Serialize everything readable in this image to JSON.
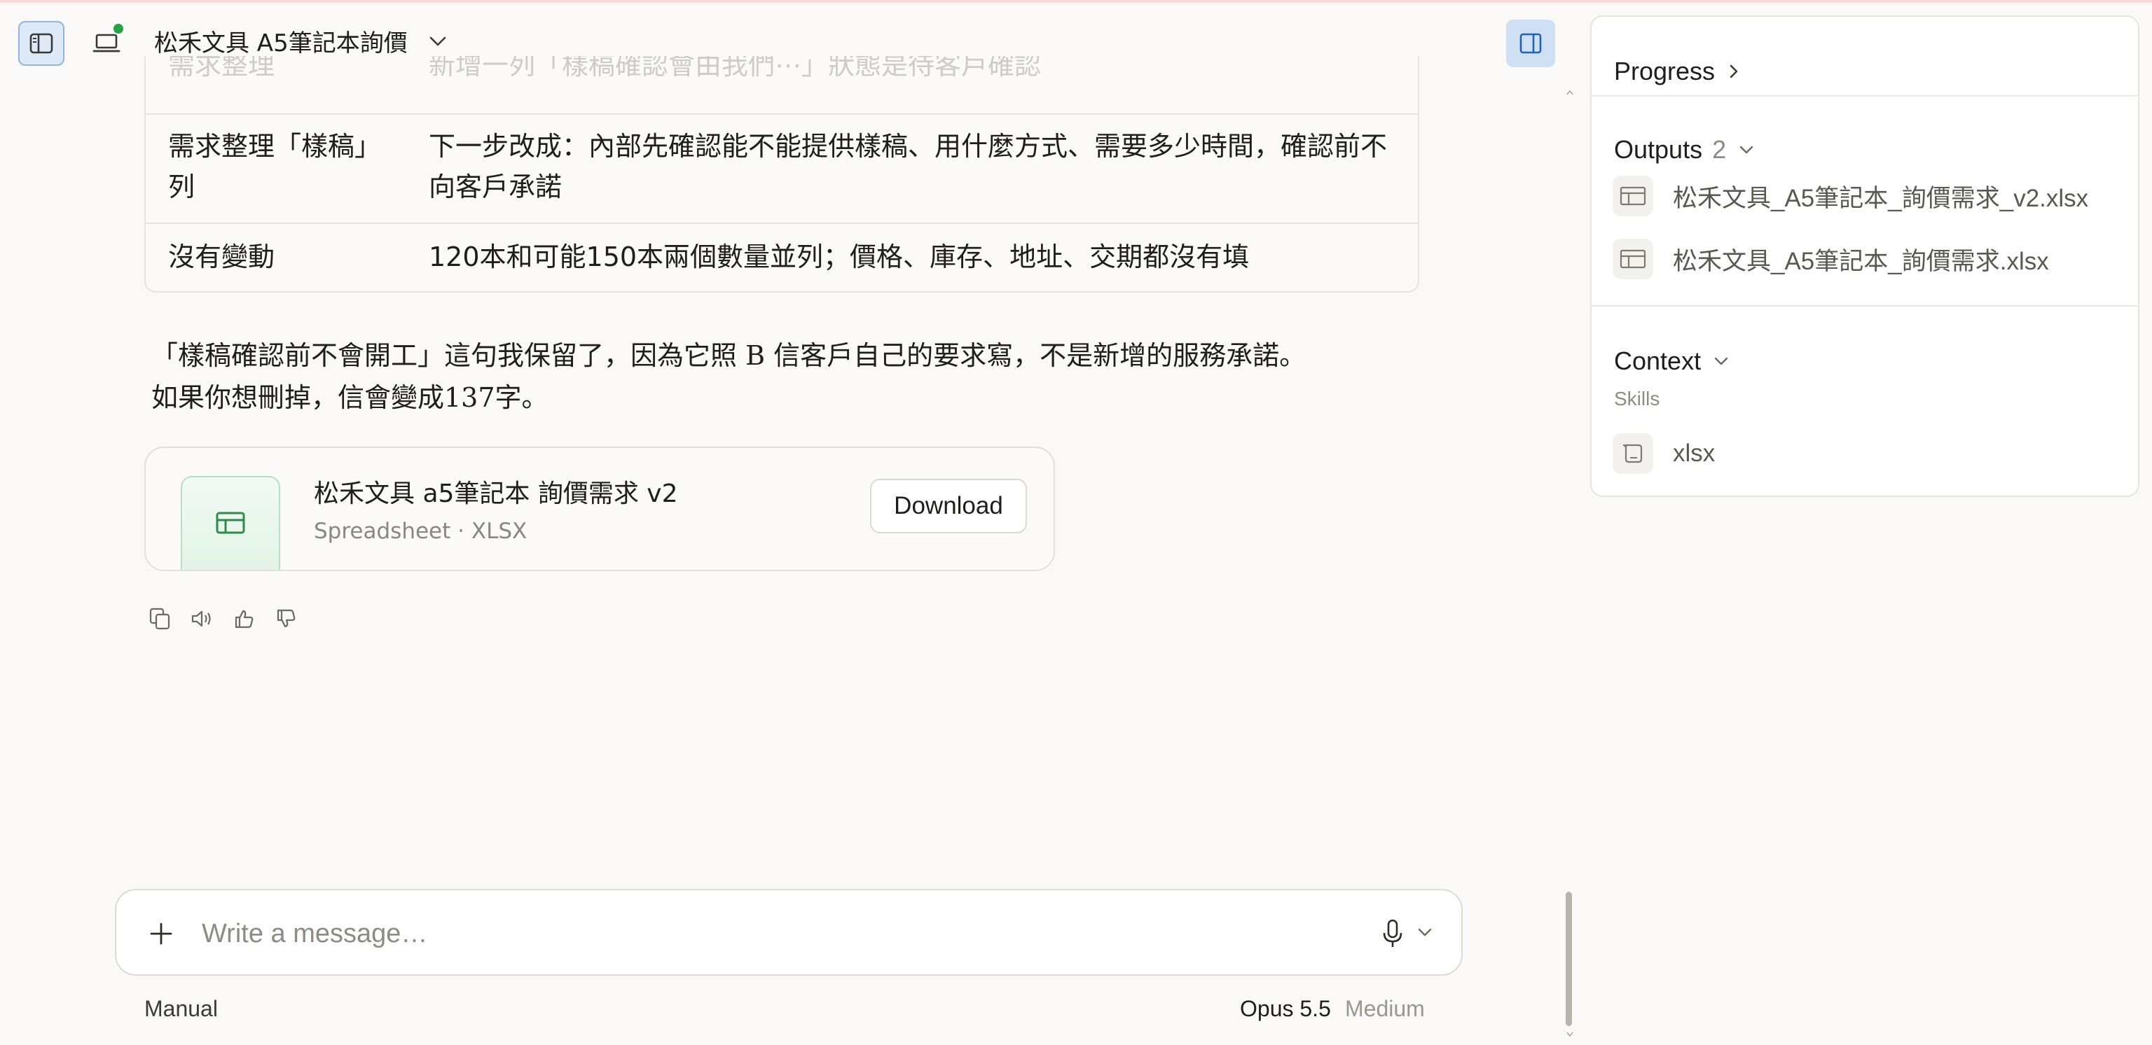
{
  "header": {
    "title": "松禾文具 A5筆記本詢價"
  },
  "table": {
    "faded_row": [
      "需求整理",
      "新增一列「樣稿確認會由我們⋯」狀態是待客戶確認"
    ],
    "rows": [
      {
        "col1": "需求整理「樣稿」列",
        "col2": "下一步改成：內部先確認能不能提供樣稿、用什麼方式、需要多少時間，確認前不向客戶承諾"
      },
      {
        "col1": "沒有變動",
        "col2": "120本和可能150本兩個數量並列；價格、庫存、地址、交期都沒有填"
      }
    ]
  },
  "message": {
    "line1": "「樣稿確認前不會開工」這句我保留了，因為它照 B 信客戶自己的要求寫，不是新增的服務承諾。",
    "line2": "如果你想刪掉，信會變成137字。"
  },
  "file_card": {
    "name": "松禾文具 a5筆記本 詢價需求 v2",
    "subtitle": "Spreadsheet · XLSX",
    "download_label": "Download"
  },
  "composer": {
    "placeholder": "Write a message…",
    "mode": "Manual",
    "model": "Opus 5.5",
    "effort": "Medium"
  },
  "right_panel": {
    "progress_title": "Progress",
    "outputs_title": "Outputs",
    "outputs_count": "2",
    "outputs": [
      {
        "name": "松禾文具_A5筆記本_詢價需求_v2.xlsx",
        "icon": "spreadsheet-icon"
      },
      {
        "name": "松禾文具_A5筆記本_詢價需求.xlsx",
        "icon": "spreadsheet-icon"
      }
    ],
    "context_title": "Context",
    "skills_label": "Skills",
    "skills": [
      {
        "name": "xlsx",
        "icon": "scroll-icon"
      }
    ]
  },
  "colors": {
    "accent_blue": "#cfe0f5",
    "online_green": "#25a244",
    "spreadsheet_green": "#2f8a4a"
  }
}
